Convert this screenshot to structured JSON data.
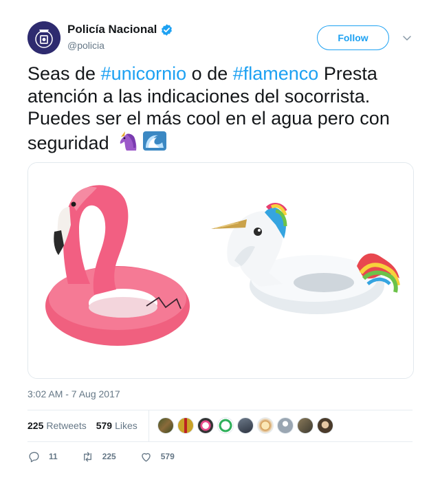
{
  "account": {
    "display_name": "Policía Nacional",
    "handle": "@policia",
    "follow_label": "Follow",
    "accent": "#1da1f2"
  },
  "tweet": {
    "text_pre": "Seas de ",
    "hashtag1": "#unicornio",
    "text_mid": " o de ",
    "hashtag2": "#flamenco",
    "text_post": " Presta atención a las indicaciones del socorrista. Puedes ser el más cool en el agua pero con seguridad",
    "emojis": [
      "unicorn-emoji",
      "wave-emoji"
    ]
  },
  "media": {
    "items": [
      "pink-flamingo-float",
      "white-unicorn-float"
    ]
  },
  "timestamp": "3:02 AM - 7 Aug 2017",
  "stats": {
    "retweets_count": "225",
    "retweets_label": "Retweets",
    "likes_count": "579",
    "likes_label": "Likes",
    "liker_avatars": 9
  },
  "actions": {
    "reply_count": "11",
    "retweet_count": "225",
    "like_count": "579"
  }
}
